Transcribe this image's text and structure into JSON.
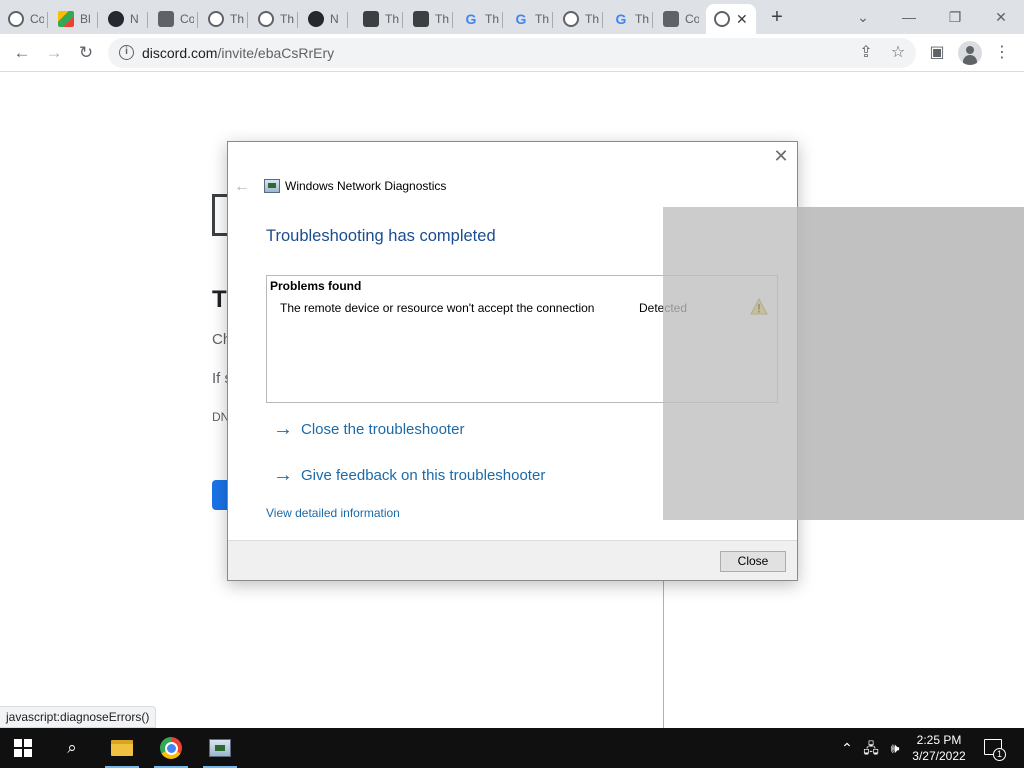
{
  "browser": {
    "tabs": [
      {
        "icon": "globe-icon",
        "title": "Co"
      },
      {
        "icon": "drive-icon",
        "title": "Bl"
      },
      {
        "icon": "github-icon",
        "title": "N"
      },
      {
        "icon": "cube-icon",
        "title": "Co"
      },
      {
        "icon": "globe-icon",
        "title": "Th"
      },
      {
        "icon": "globe-icon",
        "title": "Th"
      },
      {
        "icon": "github-icon",
        "title": "N"
      },
      {
        "icon": "dark-app-icon",
        "title": "Th"
      },
      {
        "icon": "dark-app-icon",
        "title": "Th"
      },
      {
        "icon": "google-icon",
        "title": "Th"
      },
      {
        "icon": "google-icon",
        "title": "Th"
      },
      {
        "icon": "globe-icon",
        "title": "Th"
      },
      {
        "icon": "google-icon",
        "title": "Th"
      },
      {
        "icon": "cube-icon",
        "title": "Co"
      }
    ],
    "active_tab_icon": "globe-icon",
    "url_host": "discord.com",
    "url_path": "/invite/ebaCsRrEry",
    "status_text": "javascript:diagnoseErrors()"
  },
  "page": {
    "title_partial": "Th",
    "line1_partial": "Ch",
    "line2_partial": "If s",
    "code_partial": "DN"
  },
  "dialog": {
    "app_title": "Windows Network Diagnostics",
    "heading": "Troubleshooting has completed",
    "problems_header": "Problems found",
    "problem_text": "The remote device or resource won't accept the connection",
    "problem_status": "Detected",
    "link_close": "Close the troubleshooter",
    "link_feedback": "Give feedback on this troubleshooter",
    "view_details": "View detailed information",
    "close_button": "Close"
  },
  "taskbar": {
    "time": "2:25 PM",
    "date": "3/27/2022",
    "notification_count": "1"
  },
  "colors": {
    "dialog_heading": "#1a4d8f",
    "link": "#1c6aa8",
    "taskbar": "#101010",
    "tabstrip": "#dee1e6"
  }
}
